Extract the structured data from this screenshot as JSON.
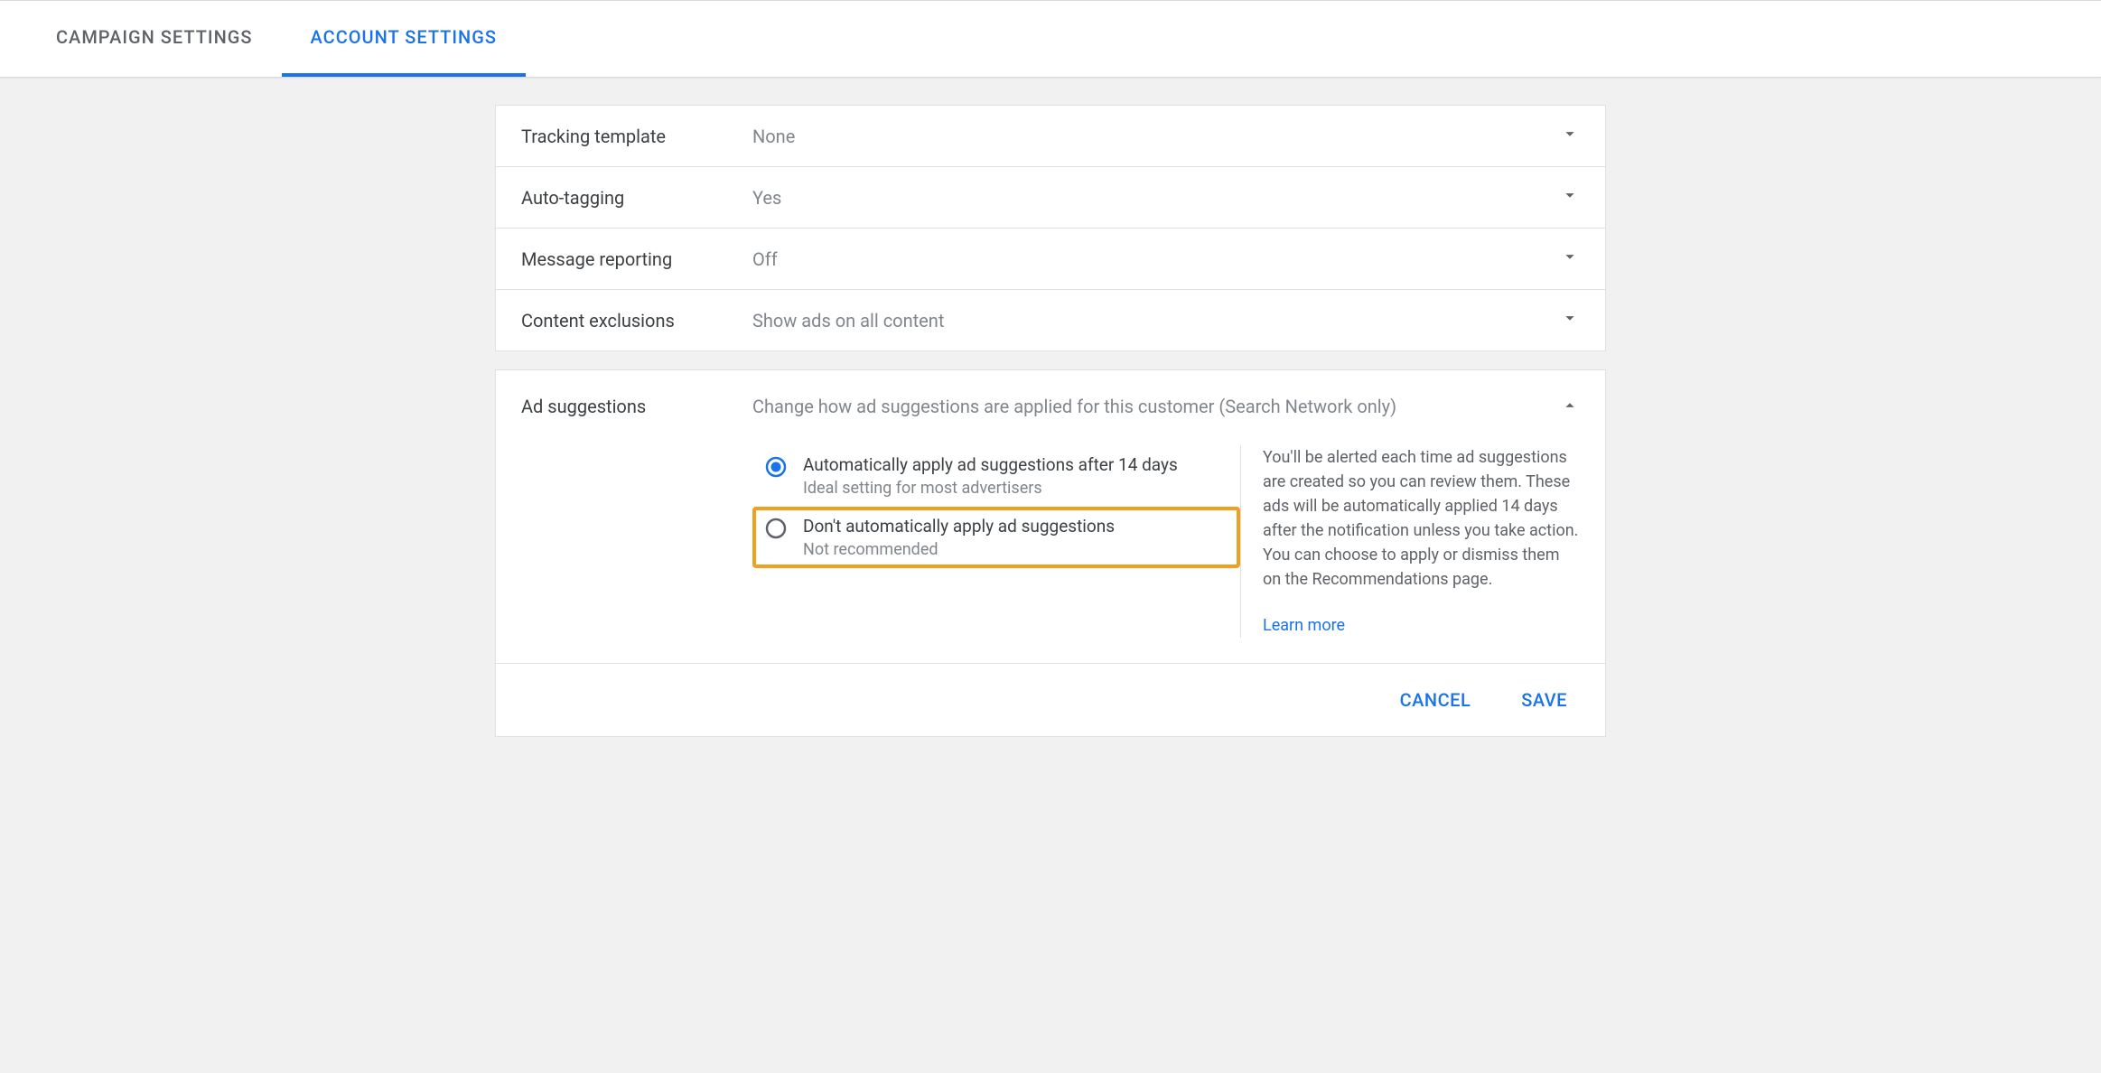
{
  "tabs": {
    "campaign": "Campaign settings",
    "account": "Account settings"
  },
  "rows": [
    {
      "label": "Tracking template",
      "value": "None"
    },
    {
      "label": "Auto-tagging",
      "value": "Yes"
    },
    {
      "label": "Message reporting",
      "value": "Off"
    },
    {
      "label": "Content exclusions",
      "value": "Show ads on all content"
    }
  ],
  "expanded": {
    "label": "Ad suggestions",
    "description": "Change how ad suggestions are applied for this customer (Search Network only)",
    "options": [
      {
        "title": "Automatically apply ad suggestions after 14 days",
        "sub": "Ideal setting for most advertisers",
        "selected": true
      },
      {
        "title": "Don't automatically apply ad suggestions",
        "sub": "Not recommended",
        "selected": false
      }
    ],
    "info": "You'll be alerted each time ad suggestions are created so you can review them. These ads will be automatically applied 14 days after the notification unless you take action. You can choose to apply or dismiss them on the Recommendations page.",
    "learn_more": "Learn more"
  },
  "actions": {
    "cancel": "Cancel",
    "save": "Save"
  }
}
